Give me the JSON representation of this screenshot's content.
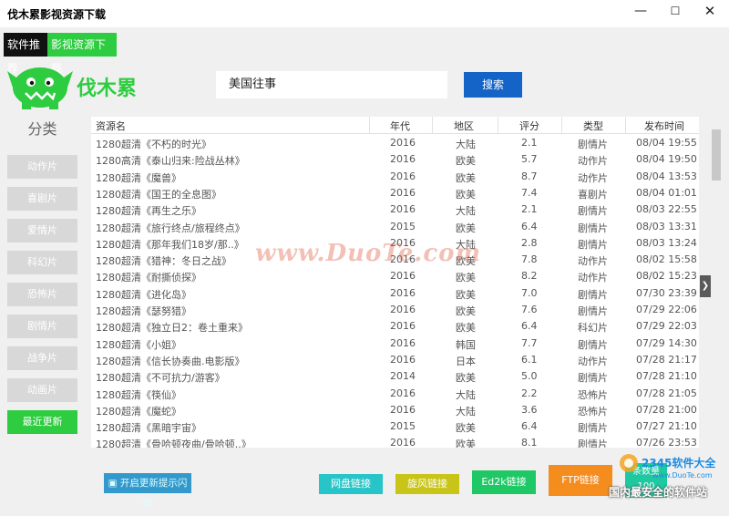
{
  "window": {
    "title": "伐木累影视资源下载"
  },
  "tabs": [
    {
      "label": "软件推荐"
    },
    {
      "label": "影视资源下载"
    }
  ],
  "logo": {
    "text": "伐木累",
    "color": "#2ecc40"
  },
  "search": {
    "value": "美国往事",
    "button_label": "搜索"
  },
  "categories": {
    "title": "分类",
    "items": [
      {
        "label": "动作片"
      },
      {
        "label": "喜剧片"
      },
      {
        "label": "爱情片"
      },
      {
        "label": "科幻片"
      },
      {
        "label": "恐怖片"
      },
      {
        "label": "剧情片"
      },
      {
        "label": "战争片"
      },
      {
        "label": "动画片"
      },
      {
        "label": "最近更新",
        "active": true
      }
    ]
  },
  "table": {
    "columns": [
      "资源名",
      "年代",
      "地区",
      "评分",
      "类型",
      "发布时间"
    ],
    "rows": [
      {
        "name": "1280超清《不朽的时光》",
        "year": "2016",
        "region": "大陆",
        "score": "2.1",
        "type": "剧情片",
        "time": "08/04 19:55"
      },
      {
        "name": "1280高清《泰山归来:险战丛林》",
        "year": "2016",
        "region": "欧美",
        "score": "5.7",
        "type": "动作片",
        "time": "08/04 19:50"
      },
      {
        "name": "1280超清《魔兽》",
        "year": "2016",
        "region": "欧美",
        "score": "8.7",
        "type": "动作片",
        "time": "08/04 13:53"
      },
      {
        "name": "1280超清《国王的全息图》",
        "year": "2016",
        "region": "欧美",
        "score": "7.4",
        "type": "喜剧片",
        "time": "08/04 01:01"
      },
      {
        "name": "1280超清《再生之乐》",
        "year": "2016",
        "region": "大陆",
        "score": "2.1",
        "type": "剧情片",
        "time": "08/03 22:55"
      },
      {
        "name": "1280超清《旅行终点/旅程终点》",
        "year": "2015",
        "region": "欧美",
        "score": "6.4",
        "type": "剧情片",
        "time": "08/03 13:31"
      },
      {
        "name": "1280超清《那年我们18岁/那..》",
        "year": "2016",
        "region": "大陆",
        "score": "2.8",
        "type": "剧情片",
        "time": "08/03 13:24"
      },
      {
        "name": "1280超清《猎神：冬日之战》",
        "year": "2016",
        "region": "欧美",
        "score": "7.8",
        "type": "动作片",
        "time": "08/02 15:58"
      },
      {
        "name": "1280超清《耐撕侦探》",
        "year": "2016",
        "region": "欧美",
        "score": "8.2",
        "type": "动作片",
        "time": "08/02 15:23"
      },
      {
        "name": "1280超清《进化岛》",
        "year": "2016",
        "region": "欧美",
        "score": "7.0",
        "type": "剧情片",
        "time": "07/30 23:39"
      },
      {
        "name": "1280超清《瑟努猎》",
        "year": "2016",
        "region": "欧美",
        "score": "7.6",
        "type": "剧情片",
        "time": "07/29 22:06"
      },
      {
        "name": "1280超清《独立日2：卷土重来》",
        "year": "2016",
        "region": "欧美",
        "score": "6.4",
        "type": "科幻片",
        "time": "07/29 22:03"
      },
      {
        "name": "1280超清《小姐》",
        "year": "2016",
        "region": "韩国",
        "score": "7.7",
        "type": "剧情片",
        "time": "07/29 14:30"
      },
      {
        "name": "1280超清《信长协奏曲.电影版》",
        "year": "2016",
        "region": "日本",
        "score": "6.1",
        "type": "动作片",
        "time": "07/28 21:17"
      },
      {
        "name": "1280超清《不可抗力/游客》",
        "year": "2014",
        "region": "欧美",
        "score": "5.0",
        "type": "剧情片",
        "time": "07/28 21:10"
      },
      {
        "name": "1280超清《筷仙》",
        "year": "2016",
        "region": "大陆",
        "score": "2.2",
        "type": "恐怖片",
        "time": "07/28 21:05"
      },
      {
        "name": "1280超清《魔蛇》",
        "year": "2016",
        "region": "大陆",
        "score": "3.6",
        "type": "恐怖片",
        "time": "07/28 21:00"
      },
      {
        "name": "1280超清《黑暗宇宙》",
        "year": "2015",
        "region": "欧美",
        "score": "6.4",
        "type": "剧情片",
        "time": "07/27 21:10"
      },
      {
        "name": "1280超清《骨哈顿夜曲/骨哈顿..》",
        "year": "2016",
        "region": "欧美",
        "score": "8.1",
        "type": "剧情片",
        "time": "07/26 23:53"
      }
    ]
  },
  "buttons": {
    "notify": "开启更新提示闪烁",
    "pan": "网盘链接",
    "xuanfeng": "旋风链接",
    "ed2k": "Ed2k链接",
    "ftp": "FTP链接",
    "count_label": "条数量",
    "count_value": "100"
  },
  "watermark": {
    "site": "www.DuoTe.com",
    "corner_site": "www.DuoTe.com",
    "corner_brand": "2345软件大全",
    "corner_slogan": "国内最安全的软件站"
  }
}
